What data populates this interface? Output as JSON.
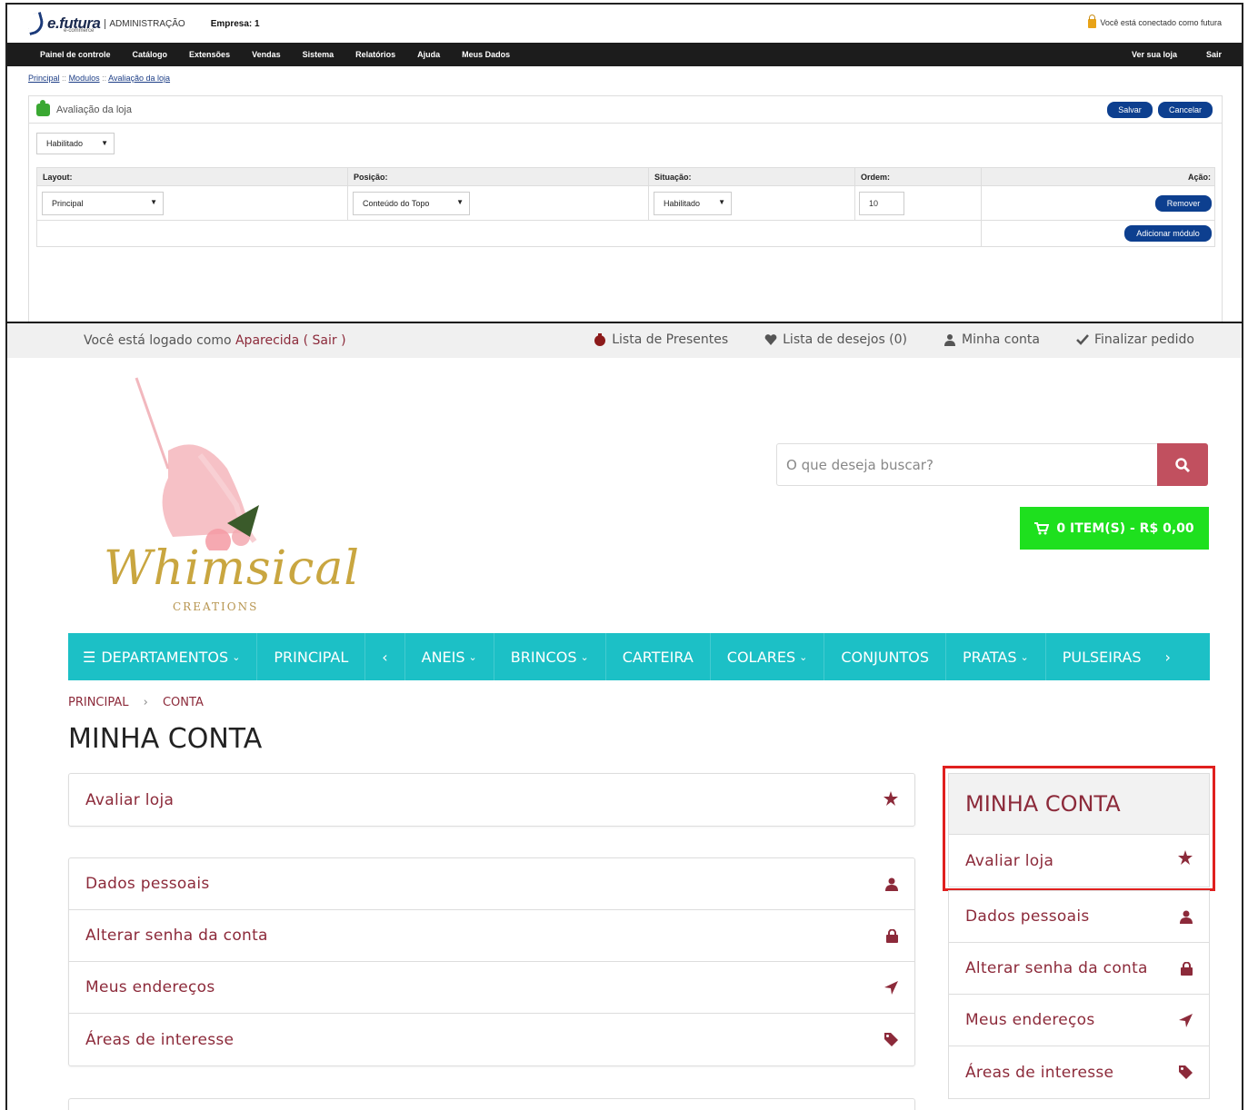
{
  "admin": {
    "logo_brand": "e.futura",
    "logo_sub": "e-commerce",
    "logo_adm": "ADMINISTRAÇÃO",
    "empresa": "Empresa: 1",
    "connected": "Você está conectado como futura",
    "nav": [
      "Painel de controle",
      "Catálogo",
      "Extensões",
      "Vendas",
      "Sistema",
      "Relatórios",
      "Ajuda",
      "Meus Dados"
    ],
    "nav_right": [
      "Ver sua loja",
      "Sair"
    ],
    "breadcrumb": [
      "Principal",
      "Modulos",
      "Avaliação da loja"
    ],
    "breadcrumb_sep": "::",
    "box_title": "Avaliação da loja",
    "save_label": "Salvar",
    "cancel_label": "Cancelar",
    "status_select": "Habilitado",
    "table": {
      "headers": [
        "Layout:",
        "Posição:",
        "Situação:",
        "Ordem:",
        "Ação:"
      ],
      "row": {
        "layout": "Principal",
        "position": "Conteúdo do Topo",
        "status": "Habilitado",
        "order": "10"
      },
      "remove_label": "Remover",
      "add_label": "Adicionar módulo"
    }
  },
  "store": {
    "logged_prefix": "Você está logado como",
    "user_name": "Aparecida",
    "logout": "( Sair )",
    "top_links": [
      {
        "label": "Lista de Presentes",
        "icon": "gift-icon"
      },
      {
        "label": "Lista de desejos (0)",
        "icon": "heart-icon"
      },
      {
        "label": "Minha conta",
        "icon": "user-icon"
      },
      {
        "label": "Finalizar pedido",
        "icon": "check-icon"
      }
    ],
    "brand_word": "Whimsical",
    "brand_sub": "CREATIONS",
    "search_placeholder": "O que deseja buscar?",
    "cart_label": "0 ITEM(S) - R$ 0,00",
    "nav": [
      "DEPARTAMENTOS",
      "PRINCIPAL",
      "‹",
      "ANEIS",
      "BRINCOS",
      "CARTEIRA",
      "COLARES",
      "CONJUNTOS",
      "PRATAS",
      "PULSEIRAS",
      "›"
    ],
    "crumb": [
      "PRINCIPAL",
      "CONTA"
    ],
    "page_title": "MINHA CONTA",
    "review_item": "Avaliar loja",
    "account_items": [
      "Dados pessoais",
      "Alterar senha da conta",
      "Meus endereços",
      "Áreas de interesse"
    ],
    "side_title": "MINHA CONTA",
    "colors": {
      "accent": "#8c2a3a",
      "nav": "#1cc0c6",
      "cart": "#1ee01e",
      "search_btn": "#c1505f",
      "highlight": "#e0201f"
    }
  }
}
